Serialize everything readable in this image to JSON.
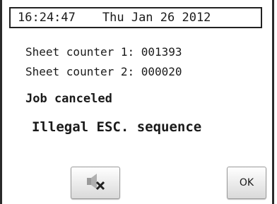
{
  "header": {
    "time": "16:24:47",
    "date": "Thu Jan 26 2012"
  },
  "counters": [
    {
      "label": "Sheet counter 1: 001393"
    },
    {
      "label": "Sheet counter 2: 000020"
    }
  ],
  "status": "Job canceled",
  "error_message": "Illegal ESC. sequence",
  "buttons": {
    "mute_icon": "speaker-muted-icon",
    "ok_label": "OK"
  }
}
